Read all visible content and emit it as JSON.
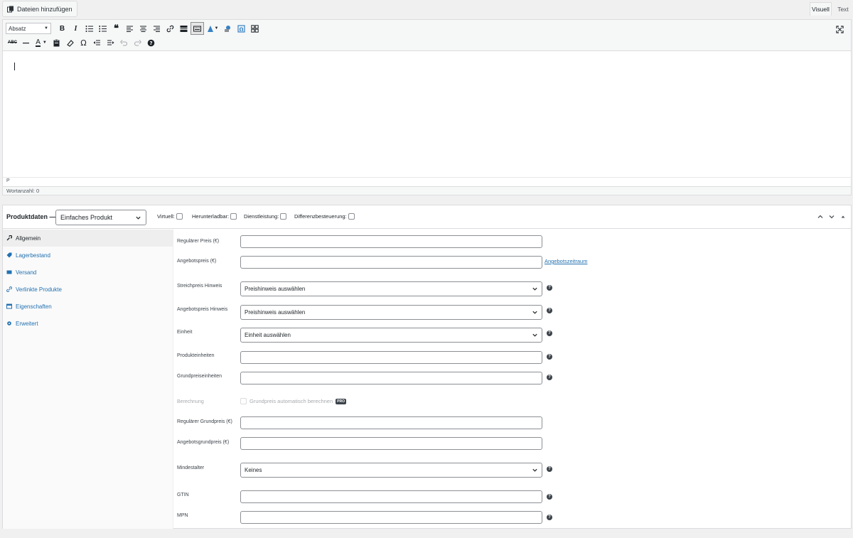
{
  "editor": {
    "add_media_label": "Dateien hinzufügen",
    "tab_visual": "Visuell",
    "tab_text": "Text",
    "format_select": "Absatz",
    "path": "P",
    "word_count": "Wortanzahl: 0"
  },
  "product_data": {
    "title": "Produktdaten —",
    "type_select": "Einfaches Produkt",
    "options": {
      "virtual": "Virtuell:",
      "downloadable": "Herunterladbar:",
      "service": "Dienstleistung:",
      "margin_tax": "Differenzbesteuerung:"
    },
    "nav": [
      "Allgemein",
      "Lagerbestand",
      "Versand",
      "Verlinkte Produkte",
      "Eigenschaften",
      "Erweitert"
    ],
    "fields": {
      "regular_price": "Regulärer Preis (€)",
      "sale_price": "Angebotspreis (€)",
      "sale_schedule_link": "Angebotszeitraum",
      "strike_price_notice": "Streichpreis Hinweis",
      "strike_price_value": "Preishinweis auswählen",
      "sale_price_notice": "Angebotspreis Hinweis",
      "sale_price_notice_value": "Preishinweis auswählen",
      "unit": "Einheit",
      "unit_value": "Einheit auswählen",
      "product_units": "Produkteinheiten",
      "base_price_units": "Grundpreiseinheiten",
      "calculation": "Berechnung",
      "calculation_checkbox": "Grundpreis automatisch berechnen",
      "pro_badge": "PRO",
      "regular_base_price": "Regulärer Grundpreis (€)",
      "sale_base_price": "Angebotsgrundpreis (€)",
      "min_age": "Mindestalter",
      "min_age_value": "Keines",
      "gtin": "GTIN",
      "mpn": "MPN"
    }
  }
}
